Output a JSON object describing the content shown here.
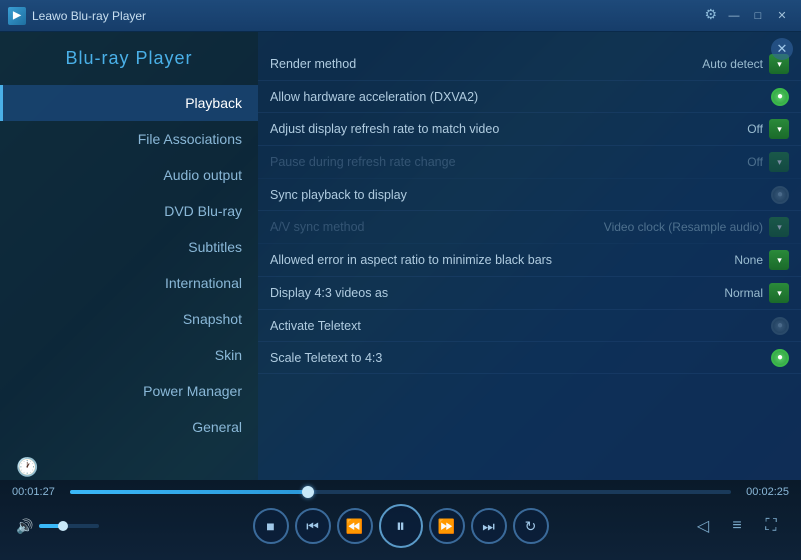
{
  "window": {
    "title": "Leawo Blu-ray Player",
    "icon": "▶"
  },
  "titlebar": {
    "minimize": "—",
    "maximize": "□",
    "close": "✕",
    "settings_icon": "⚙"
  },
  "sidebar": {
    "logo_line1": "Blu-ray Player",
    "items": [
      {
        "label": "Playback",
        "active": true
      },
      {
        "label": "File Associations",
        "active": false
      },
      {
        "label": "Audio output",
        "active": false
      },
      {
        "label": "DVD  Blu-ray",
        "active": false
      },
      {
        "label": "Subtitles",
        "active": false
      },
      {
        "label": "International",
        "active": false
      },
      {
        "label": "Snapshot",
        "active": false
      },
      {
        "label": "Skin",
        "active": false
      },
      {
        "label": "Power Manager",
        "active": false
      },
      {
        "label": "General",
        "active": false
      }
    ],
    "history_icon": "🕐"
  },
  "settings": {
    "close_icon": "✕",
    "rows": [
      {
        "label": "Render method",
        "value": "Auto detect",
        "control": "dropdown",
        "enabled": true
      },
      {
        "label": "Allow hardware acceleration (DXVA2)",
        "value": "",
        "control": "toggle-on",
        "enabled": true
      },
      {
        "label": "Adjust display refresh rate to match video",
        "value": "Off",
        "control": "dropdown",
        "enabled": true
      },
      {
        "label": "Pause during refresh rate change",
        "value": "Off",
        "control": "dropdown",
        "enabled": false
      },
      {
        "label": "Sync playback to display",
        "value": "",
        "control": "toggle-off",
        "enabled": true
      },
      {
        "label": "A/V sync method",
        "value": "Video clock (Resample audio)",
        "control": "dropdown",
        "enabled": false
      },
      {
        "label": "Allowed error in aspect ratio to minimize black bars",
        "value": "None",
        "control": "dropdown",
        "enabled": true
      },
      {
        "label": "Display 4:3 videos as",
        "value": "Normal",
        "control": "dropdown",
        "enabled": true
      },
      {
        "label": "Activate Teletext",
        "value": "",
        "control": "toggle-off",
        "enabled": true
      },
      {
        "label": "Scale Teletext to 4:3",
        "value": "",
        "control": "toggle-on",
        "enabled": true
      }
    ]
  },
  "player": {
    "time_current": "00:01:27",
    "time_total": "00:02:25",
    "progress_percent": 36,
    "volume_percent": 40,
    "controls": {
      "stop": "■",
      "prev": "⏮",
      "rewind": "⏪",
      "play_pause": "⏸",
      "forward": "⏩",
      "next": "⏭",
      "repeat": "↻"
    },
    "right_controls": {
      "share": "◁",
      "playlist": "≡",
      "fullscreen": "⛶"
    }
  }
}
